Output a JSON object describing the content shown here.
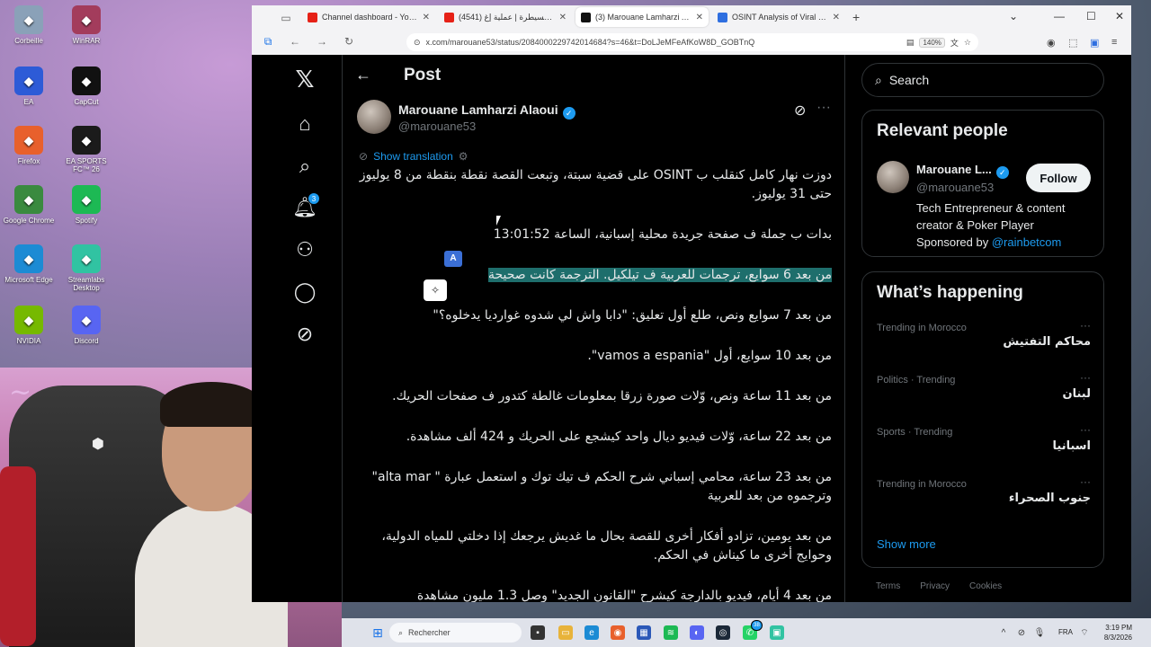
{
  "desktop": {
    "icons": [
      {
        "label": "Corbeille",
        "icon": "trash-icon",
        "color": "#8aa1b8"
      },
      {
        "label": "WinRAR",
        "icon": "winrar-icon",
        "color": "#a33c5c"
      },
      {
        "label": "EA",
        "icon": "ea-icon",
        "color": "#2d5bd7"
      },
      {
        "label": "CapCut",
        "icon": "capcut-icon",
        "color": "#111111"
      },
      {
        "label": "Firefox",
        "icon": "firefox-icon",
        "color": "#e8602c"
      },
      {
        "label": "EA SPORTS FC™ 26",
        "icon": "easports-icon",
        "color": "#1b1b1b"
      },
      {
        "label": "Google Chrome",
        "icon": "chrome-icon",
        "color": "#3a8a3f"
      },
      {
        "label": "Spotify",
        "icon": "spotify-icon",
        "color": "#1db954"
      },
      {
        "label": "Microsoft Edge",
        "icon": "edge-icon",
        "color": "#1c8bd4"
      },
      {
        "label": "Streamlabs Desktop",
        "icon": "streamlabs-icon",
        "color": "#31c3a2"
      },
      {
        "label": "NVIDIA",
        "icon": "nvidia-icon",
        "color": "#76b900"
      },
      {
        "label": "Discord",
        "icon": "discord-icon",
        "color": "#5865f2"
      }
    ]
  },
  "browser": {
    "tabs": [
      {
        "title": "Channel dashboard - YouTube S",
        "favicon_color": "#e62117",
        "active": false
      },
      {
        "title": "(4541) خارج السيطرة | عملية إغ",
        "favicon_color": "#e62117",
        "active": false
      },
      {
        "title": "(3) Marouane Lamharzi Alaoui o",
        "favicon_color": "#111111",
        "active": true
      },
      {
        "title": "OSINT Analysis of Viral Misinfor",
        "favicon_color": "#2f6fe0",
        "active": false
      }
    ],
    "url": "x.com/marouane53/status/2084000229742014684?s=46&t=DoLJeMFeAfKoW8D_GOBTnQ",
    "zoom": "140%"
  },
  "x": {
    "header_title": "Post",
    "author": {
      "name": "Marouane Lamharzi Alaoui",
      "handle": "@marouane53"
    },
    "show_translation": "Show translation",
    "post_paragraphs": [
      "دوزت نهار كامل كنقلب ب OSINT على قضية سبتة، وتبعت القصة نقطة بنقطة من 8 يوليوز حتى 31 يوليوز.",
      "بدات ب جملة ف صفحة جريدة محلية إسبانية، الساعة 13:01:52",
      "من بعد 6 سوايع، ترجمات للعربية ف تيلكيل. الترجمة كانت صحيحة",
      "من بعد 7 سوايع ونص، طلع أول تعليق: \"دابا واش لي شدوه غوارديا يدخلوه؟\"",
      "من بعد 10 سوايع، أول \"vamos a espania\".",
      "من بعد 11 ساعة ونص، وّلات صورة زرقا بمعلومات غالطة كتدور ف صفحات الحريك.",
      "من بعد 22 ساعة، وّلات فيديو ديال واحد كيشجع على الحريك و 424 ألف مشاهدة.",
      "من بعد 23 ساعة، محامي إسباني شرح الحكم ف تيك توك و استعمل عبارة \" alta mar\" وترجموه من بعد للعربية",
      "من بعد يومين، تزادو أفكار أخرى للقصة بحال ما غديش يرجعك إذا دخلتي للمياه الدولية، وحوايج أخرى ما كيناش في الحكم.",
      "من بعد 4 أيام، فيديو بالدارجة كيشرح \"القانون الجديد\" وصل 1.3 مليون مشاهدة"
    ],
    "highlighted_index": 2,
    "search_placeholder": "Search",
    "relevant_people": {
      "title": "Relevant people",
      "name": "Marouane L...",
      "handle": "@marouane53",
      "follow_label": "Follow",
      "bio": "Tech Entrepreneur & content creator & Poker Player",
      "sponsored_prefix": "Sponsored by ",
      "sponsored_link": "@rainbetcom"
    },
    "happening": {
      "title": "What’s happening",
      "trends": [
        {
          "context": "Trending in Morocco",
          "name": "محاكم التفتيش"
        },
        {
          "context": "Politics · Trending",
          "name": "لبنان"
        },
        {
          "context": "Sports · Trending",
          "name": "اسبانيا"
        },
        {
          "context": "Trending in Morocco",
          "name": "جنوب الصحراء"
        }
      ],
      "show_more": "Show more"
    },
    "footer": [
      "Terms",
      "Privacy",
      "Cookies"
    ],
    "notification_count": "3"
  },
  "taskbar": {
    "search_placeholder": "Rechercher",
    "language": "FRA",
    "time": "3:19 PM",
    "date": "8/3/2026",
    "whatsapp_badge": "38"
  },
  "colors": {
    "accent": "#1d9bf0",
    "highlight": "#1e6e6c",
    "page_bg": "#000000"
  }
}
